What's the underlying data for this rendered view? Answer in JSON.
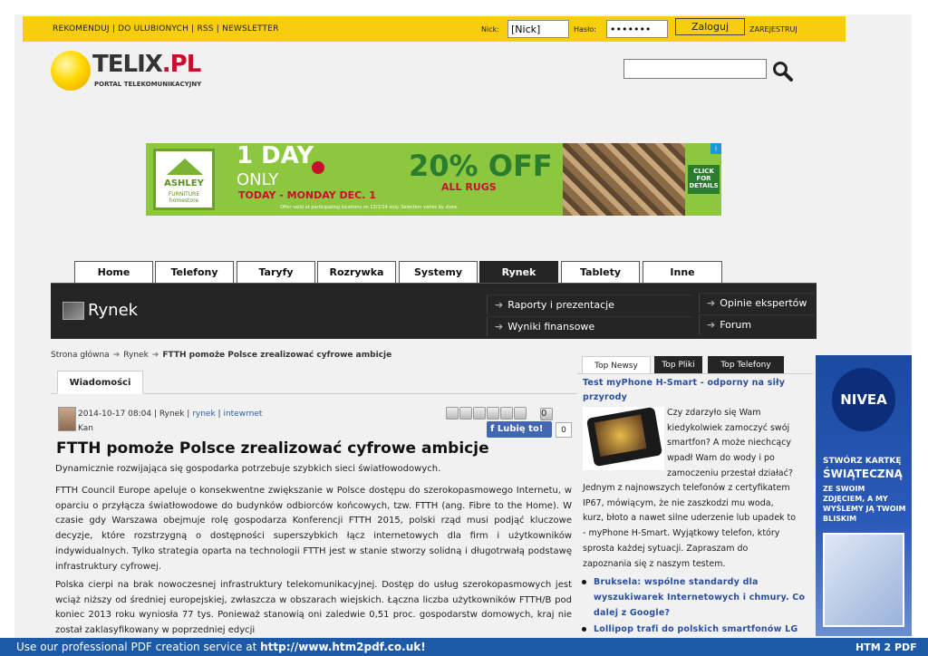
{
  "topbar": {
    "links": [
      "REKOMENDUJ",
      "DO ULUBIONYCH",
      "RSS",
      "NEWSLETTER"
    ],
    "nick_label": "Nick:",
    "nick_value": "[Nick]",
    "pass_label": "Hasło:",
    "pass_value": "•••••••",
    "login_label": "Zaloguj",
    "register_label": "ZAREJESTRUJ"
  },
  "logo": {
    "name_a": "TELIX",
    "name_b": ".PL",
    "tagline": "PORTAL TELEKOMUNIKACYJNY"
  },
  "banner": {
    "brand": "ASHLEY",
    "brand_sub": "FURNITURE homestore",
    "day_line1": "1 DAY",
    "day_line2": "ONLY",
    "today": "TODAY - MONDAY DEC. 1",
    "fine": "Offer valid at participating locations on 12/1/14 only. Selection varies by store.",
    "discount": "20% OFF",
    "rugs": "ALL RUGS",
    "cta": "CLICK FOR DETAILS",
    "ad_mark": "i"
  },
  "nav": {
    "tabs": [
      "Home",
      "Telefony",
      "Taryfy",
      "Rozrywka",
      "Systemy",
      "Rynek",
      "Tablety",
      "Inne"
    ],
    "active": "Rynek"
  },
  "section": {
    "title": "Rynek",
    "sublinks": [
      "Raporty i prezentacje",
      "Wyniki finansowe",
      "Opinie ekspertów",
      "Forum"
    ]
  },
  "breadcrumb": {
    "home": "Strona główna",
    "section": "Rynek",
    "current": "FTTH pomoże Polsce zrealizować cyfrowe ambicje"
  },
  "article": {
    "tab": "Wiadomości",
    "date": "2014-10-17 08:04",
    "category": "Rynek",
    "tag1": "rynek",
    "tag2": "intewrnet",
    "author": "Kan",
    "comment_count": "0",
    "like_label": "Lubię to!",
    "like_count": "0",
    "title": "FTTH pomoże Polsce zrealizować cyfrowe ambicje",
    "lead": "Dynamicznie rozwijająca się gospodarka potrzebuje szybkich sieci światłowodowych.",
    "p1": "FTTH Council Europe apeluje o konsekwentne zwiększanie w Polsce dostępu do szerokopasmowego Internetu, w oparciu o przyłącza światłowodowe do budynków odbiorców końcowych, tzw. FTTH (ang. Fibre to the Home). W czasie gdy Warszawa obejmuje rolę gospodarza Konferencji FTTH 2015, polski rząd musi podjąć kluczowe decyzje, które rozstrzygną o dostępności superszybkich łącz internetowych dla firm i użytkowników indywidualnych. Tylko strategia oparta na technologii FTTH jest w stanie stworzy solidną i długotrwałą podstawę infrastruktury cyfrowej.",
    "p2": "Polska cierpi na brak nowoczesnej infrastruktury telekomunikacyjnej. Dostęp do usług szerokopasmowych jest wciąż niższy od średniej europejskiej, zwłaszcza w obszarach wiejskich. Łączna liczba użytkowników FTTH/B pod koniec 2013 roku wyniosła 77 tys. Ponieważ stanowią oni zaledwie 0,51 proc. gospodarstw domowych, kraj nie został zaklasyfikowany w poprzedniej edycji"
  },
  "sidebar": {
    "tabs": [
      "Top Newsy",
      "Top Pliki",
      "Top Telefony"
    ],
    "top_title": "Test myPhone H-Smart - odporny na siły przyrody",
    "text_right": [
      "Czy zdarzyło się Wam",
      "kiedykolwiek zamoczyć swój",
      "smartfon? A może niechcący",
      "wpadł Wam do wody i po",
      "zamoczeniu przestał działać?"
    ],
    "text_full": [
      "Jednym z najnowszych telefonów z certyfikatem",
      "IP67, mówiącym, że nie zaszkodzi mu woda,",
      "kurz, błoto a nawet silne uderzenie lub upadek to",
      "- myPhone H-Smart. Wyjątkowy telefon, który",
      "sprosta każdej sytuacji. Zapraszam do",
      "zapoznania się z naszym testem."
    ],
    "bullets": [
      "Bruksela: wspólne standardy dla wyszukiwarek Internetowych i chmury. Co dalej z Google?",
      "Lollipop trafi do polskich smartfonów LG"
    ]
  },
  "side_ad": {
    "brand": "NIVEA",
    "line1": "STWÓRZ KARTKĘ",
    "line2": "ŚWIĄTECZNĄ",
    "line3": "ZE SWOIM ZDJĘCIEM, A MY WYŚLEMY JĄ TWOIM BLISKIM"
  },
  "footer": {
    "text": "Use our professional PDF creation service at ",
    "url": "http://www.htm2pdf.co.uk!",
    "logo": "HTM 2 PDF"
  }
}
